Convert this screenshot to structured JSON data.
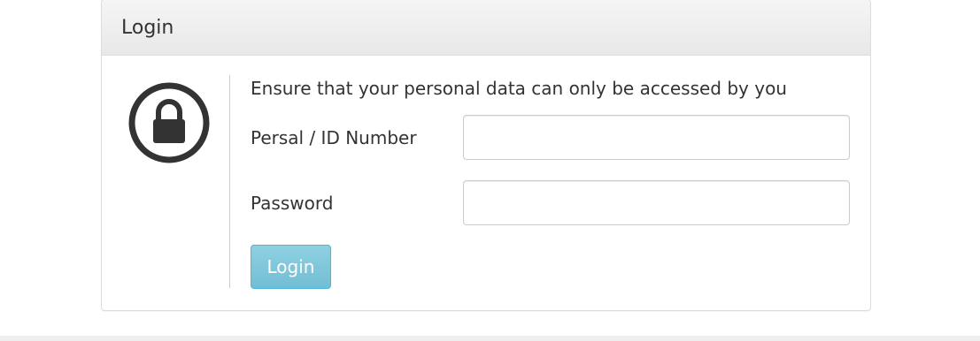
{
  "panel": {
    "title": "Login"
  },
  "form": {
    "intro": "Ensure that your personal data can only be accessed by you",
    "username_label": "Persal / ID Number",
    "username_value": "",
    "password_label": "Password",
    "password_value": "",
    "submit_label": "Login"
  },
  "icons": {
    "lock": "lock-icon"
  },
  "colors": {
    "button_bg": "#7ec6db",
    "button_border": "#46b8da",
    "header_bg": "#eeeeee",
    "text": "#333333"
  }
}
